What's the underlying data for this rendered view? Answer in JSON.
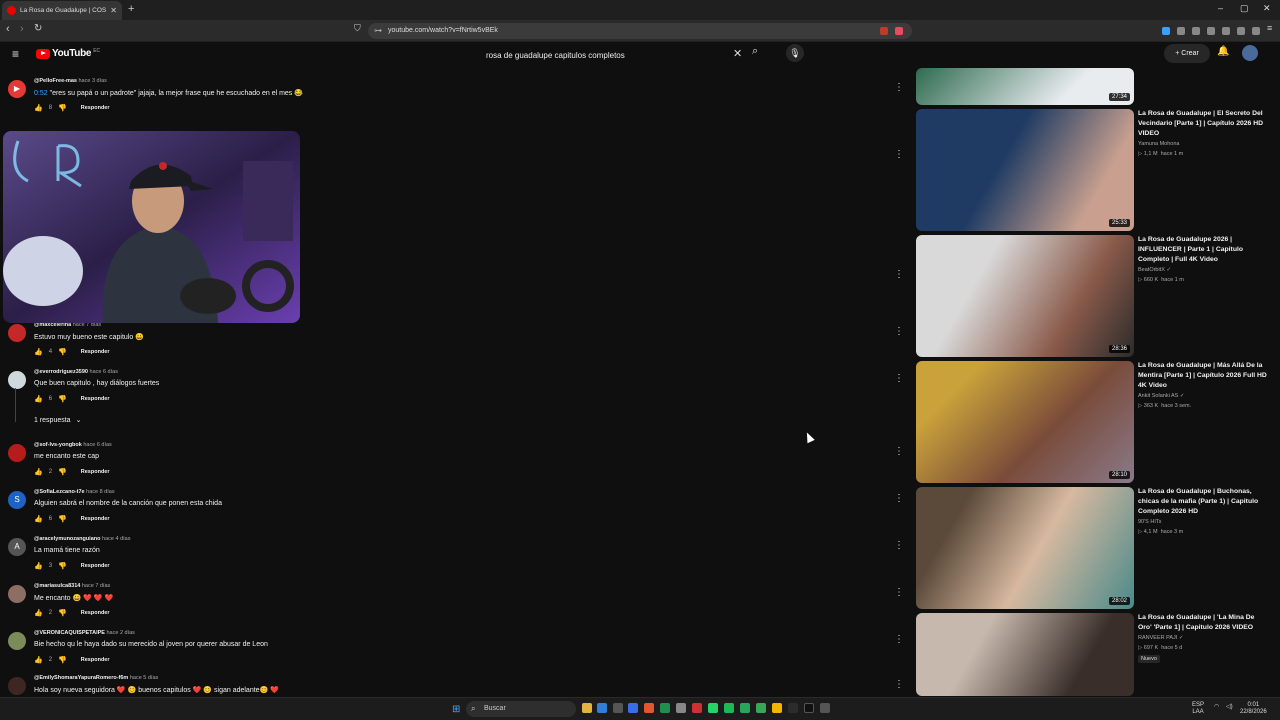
{
  "browser": {
    "tab_title": "La Rosa de Guadalupe | COSAS",
    "url": "youtube.com/watch?v=fNrtiw5vBEk",
    "new_tab": "+",
    "controls": [
      "–",
      "▢",
      "✕"
    ]
  },
  "youtube": {
    "logo": "YouTube",
    "logo_country": "EC",
    "search_value": "rosa de guadalupe capitulos completos",
    "create_label": "Crear"
  },
  "comments": [
    {
      "author": "@PelloFree-mas",
      "time": "hace 3 días",
      "timestamp": "0:52",
      "text": "\"eres su papá o un padrote\" jajaja, la mejor frase que he escuchado en el mes 😂",
      "likes": "8",
      "reply": "Responder",
      "avatar_color": "#e53935",
      "avatar_glyph": "▶"
    },
    {
      "author": "@maxcelerina",
      "time": "hace 7 días",
      "timestamp": "",
      "text": "Estuvo muy bueno este capitulo 😀",
      "likes": "4",
      "reply": "Responder",
      "avatar_color": "#c62828",
      "avatar_glyph": ""
    },
    {
      "author": "@everrodriguez3590",
      "time": "hace 6 días",
      "timestamp": "",
      "text": "Que buen capitulo , hay diálogos fuertes",
      "likes": "6",
      "reply": "Responder",
      "avatar_color": "#cfd8dc",
      "avatar_glyph": ""
    },
    {
      "author": "@sof-lvs-yongbok",
      "time": "hace 6 días",
      "timestamp": "",
      "text": "me encanto este cap",
      "likes": "2",
      "reply": "Responder",
      "avatar_color": "#b71c1c",
      "avatar_glyph": ""
    },
    {
      "author": "@SofiaLezcano-t7e",
      "time": "hace 8 días",
      "timestamp": "",
      "text": "Alguien sabrá el nombre de la canción que ponen esta chida",
      "likes": "6",
      "reply": "Responder",
      "avatar_color": "#1e63c4",
      "avatar_glyph": "S"
    },
    {
      "author": "@aracelymunozanguiano",
      "time": "hace 4 días",
      "timestamp": "",
      "text": "La mamá tiene razón",
      "likes": "3",
      "reply": "Responder",
      "avatar_color": "#555",
      "avatar_glyph": "A"
    },
    {
      "author": "@mariasulca8314",
      "time": "hace 7 días",
      "timestamp": "",
      "text": "Me encanto 😀 ❤️ ❤️ ❤️",
      "likes": "2",
      "reply": "Responder",
      "avatar_color": "#8d6e63",
      "avatar_glyph": ""
    },
    {
      "author": "@VERONICAQUISPETAIPE",
      "time": "hace 2 días",
      "timestamp": "",
      "text": "Bie hecho qu le haya dado su merecido al joven por querer abusar de Leon",
      "likes": "2",
      "reply": "Responder",
      "avatar_color": "#7c8b5a",
      "avatar_glyph": ""
    },
    {
      "author": "@EmilyShomaraYapuraRomero-f6m",
      "time": "hace 5 días",
      "timestamp": "",
      "text": "Hola soy nueva seguidora ❤️ 😊 buenos capitulos ❤️ 😊 sigan adelante😊 ❤️",
      "likes": "",
      "reply": "",
      "avatar_color": "#3e2723",
      "avatar_glyph": ""
    }
  ],
  "replies_toggle": "1 respuesta",
  "videos": [
    {
      "title": "",
      "channel": "",
      "views": "",
      "age": "",
      "duration": "27:34",
      "badge": "",
      "verified": false,
      "thumb_colors": [
        "#2e6b50",
        "#e9ecef"
      ]
    },
    {
      "title": "La Rosa de Guadalupe | El Secreto Del Vecindario [Parte 1] | Capítulo 2026 HD VIDEO",
      "channel": "Yamuna Mohona",
      "views": "1,1 M",
      "age": "hace 1 m",
      "duration": "25:33",
      "badge": "",
      "verified": false,
      "thumb_colors": [
        "#1f3b63",
        "#c9a08f"
      ]
    },
    {
      "title": "La Rosa de Guadalupe 2026 | INFLUENCER | Parte 1 | Capitulo Completo | Full 4K Video",
      "channel": "BeatOrbitX",
      "views": "660 K",
      "age": "hace 1 m",
      "duration": "28:36",
      "badge": "",
      "verified": true,
      "thumb_colors": [
        "#d9d9d9",
        "#8a5a4a"
      ]
    },
    {
      "title": "La Rosa de Guadalupe | Más Allá De la Mentira [Parte 1] | Capítulo 2026 Full HD 4K Video",
      "channel": "Ankit Solanki AS",
      "views": "363 K",
      "age": "hace 3 sem.",
      "duration": "28:10",
      "badge": "",
      "verified": true,
      "thumb_colors": [
        "#c9a23b",
        "#7a4b3a"
      ]
    },
    {
      "title": "La Rosa de Guadalupe | Buchonas, chicas de la mafia (Parte 1) | Capitulo Completo 2026 HD",
      "channel": "90'S HITs",
      "views": "4,1 M",
      "age": "hace 3 m",
      "duration": "28:02",
      "badge": "",
      "verified": false,
      "thumb_colors": [
        "#5b4a3a",
        "#d7b9a0"
      ]
    },
    {
      "title": "La Rosa de Guadalupe | 'La Mina De Oro' 'Parte 1] | Capitulo 2026 VIDEO",
      "channel": "RANVEER PAJI",
      "views": "697 K",
      "age": "hace 5 d",
      "duration": "",
      "badge": "Nuevo",
      "verified": true,
      "thumb_colors": [
        "#c6b8ac",
        "#3a2e2a"
      ]
    }
  ],
  "taskbar": {
    "search_label": "Buscar",
    "lang": "ESP",
    "lang_sub": "LAA",
    "time": "0:01",
    "date": "22/8/2026"
  },
  "icons": {
    "views": "▷",
    "verified": "✓",
    "like": "👍",
    "dislike": "👎",
    "menu": "⋮"
  }
}
